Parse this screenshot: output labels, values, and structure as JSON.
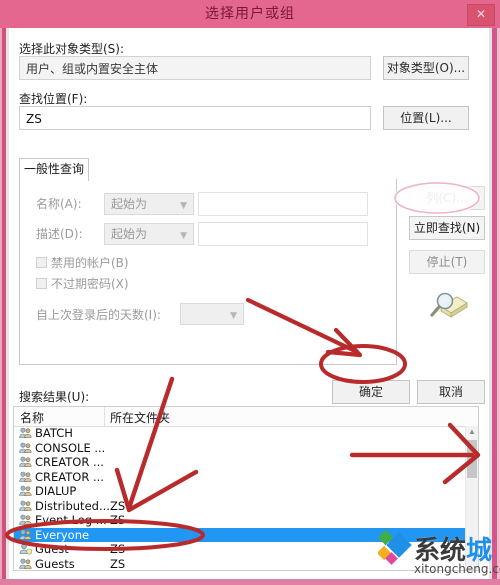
{
  "window": {
    "title": "选择用户或组",
    "close_label": "✕"
  },
  "upper": {
    "object_type_label": "选择此对象类型(S):",
    "object_type_value": "用户、组或内置安全主体",
    "object_type_button": "对象类型(O)...",
    "location_label": "查找位置(F):",
    "location_value": "ZS",
    "location_button": "位置(L)..."
  },
  "tabs": {
    "common_query": "一般性查询"
  },
  "query": {
    "name_label": "名称(A):",
    "name_condition": "起始为",
    "name_value": "",
    "desc_label": "描述(D):",
    "desc_condition": "起始为",
    "desc_value": "",
    "disabled_accounts_label": "禁用的帐户(B)",
    "non_expiring_password_label": "不过期密码(X)",
    "days_since_logon_label": "自上次登录后的天数(I):",
    "days_since_logon_value": ""
  },
  "commands": {
    "columns": "列(C)...",
    "find_now": "立即查找(N)",
    "stop": "停止(T)",
    "magnifier_icon": "search-folder-icon"
  },
  "dialog_buttons": {
    "ok": "确定",
    "cancel": "取消"
  },
  "results": {
    "label": "搜索结果(U):",
    "columns": [
      "名称",
      "所在文件夹"
    ],
    "rows": [
      {
        "name": "BATCH",
        "folder": "",
        "icon": "group-icon",
        "selected": false
      },
      {
        "name": "CONSOLE ...",
        "folder": "",
        "icon": "group-icon",
        "selected": false
      },
      {
        "name": "CREATOR ...",
        "folder": "",
        "icon": "group-icon",
        "selected": false
      },
      {
        "name": "CREATOR ...",
        "folder": "",
        "icon": "group-icon",
        "selected": false
      },
      {
        "name": "DIALUP",
        "folder": "",
        "icon": "group-icon",
        "selected": false
      },
      {
        "name": "Distributed...",
        "folder": "ZS",
        "icon": "group-icon",
        "selected": false
      },
      {
        "name": "Event Log ...",
        "folder": "ZS",
        "icon": "group-icon",
        "selected": false
      },
      {
        "name": "Everyone",
        "folder": "",
        "icon": "group-icon",
        "selected": true
      },
      {
        "name": "Guest",
        "folder": "ZS",
        "icon": "user-icon",
        "selected": false
      },
      {
        "name": "Guests",
        "folder": "ZS",
        "icon": "group-icon",
        "selected": false
      }
    ]
  },
  "annotations": {
    "marker_color": "#b92b2b",
    "ellipse_find_now": "立即查找(N)",
    "ellipse_ok": "确定",
    "ellipse_everyone": "Everyone"
  },
  "watermark": {
    "brand_first": "系统",
    "brand_second": "城",
    "url": "xitongcheng.com",
    "logo_colors": [
      "#3fae49",
      "#1f8fe8",
      "#f2b021",
      "#e0479e"
    ]
  },
  "colors": {
    "titlebar": "#e3678f",
    "frame": "#d0517c",
    "selection": "#2196f3",
    "marker": "#b92b2b"
  }
}
